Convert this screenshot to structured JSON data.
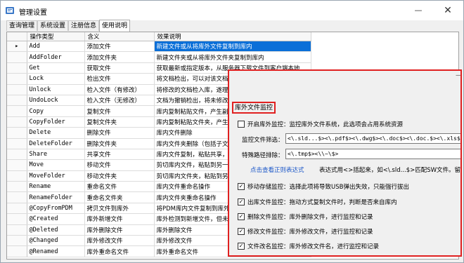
{
  "window": {
    "title": "管理设置",
    "minimize": "—",
    "close": "✕"
  },
  "tabs": [
    "查询管理",
    "系统设置",
    "注册信息",
    "使用说明"
  ],
  "grid": {
    "columns": [
      "操作类型",
      "含义",
      "效果说明"
    ],
    "rows": [
      [
        "Add",
        "添加文件",
        "新建文件或从将库外文件复制到库内"
      ],
      [
        "AddFolder",
        "添加文件夹",
        "新建文件夹或从将库外文件夹复制到库内"
      ],
      [
        "Get",
        "获取文件",
        "获取最新或指定版本，从服务器下载文件到客户端本地"
      ],
      [
        "Lock",
        "检出文件",
        "将文档检出，可以对该文档检出"
      ],
      [
        "Unlock",
        "检入文件（有修改）",
        "将修改的文档检入库，遂理版"
      ],
      [
        "UndoLock",
        "检入文件（无修改）",
        "文档为撤销检出，将未修改的"
      ],
      [
        "Copy",
        "复制文件",
        "库内复制粘贴文件，产生副本"
      ],
      [
        "CopyFolder",
        "复制文件夹",
        "库内复制粘贴文件夹，产生副"
      ],
      [
        "Delete",
        "删除文件",
        "库内文件删除"
      ],
      [
        "DeleteFolder",
        "删除文件夹",
        "库内文件夹删除（包括子文件"
      ],
      [
        "Share",
        "共享文件",
        "库内文件复制，粘贴共享，产"
      ],
      [
        "Move",
        "移动文件",
        "剪切库内文件，粘贴到另一个"
      ],
      [
        "MoveFolder",
        "移动文件夹",
        "剪切库内文件夹，粘贴到另一"
      ],
      [
        "Rename",
        "重命名文件",
        "库内文件重命名操作"
      ],
      [
        "RenameFolder",
        "重命名文件夹",
        "库内文件夹重命名操作"
      ],
      [
        "@CopyFromPDM",
        "拷贝文件到库外",
        "将PDM库内文件复制到库外"
      ],
      [
        "@Created",
        "库外新增文件",
        "库外检测到新增文件，但未"
      ],
      [
        "@Deleted",
        "库外删除文件",
        "库外删除文件"
      ],
      [
        "@Changed",
        "库外修改文件",
        "库外修改文件"
      ],
      [
        "@Renamed",
        "库外重命名文件",
        "库外重命名文件"
      ]
    ],
    "selected_row_marker": "▸"
  },
  "monitor": {
    "minimize": "—",
    "section_title": "库外文件监控",
    "enable_label": "开启库外监控：监控库外文件系统，此选项会占用系统资源",
    "filter_label": "监控文件筛选：",
    "filter_value": "<\\.sld...$><\\.pdf$><\\.dwg$><\\.doc$><\\.doc.$><\\.xls$><\\.xls.$>",
    "exclude_label": "特殊路径排除：",
    "exclude_value": "<\\.tmp$><\\\\~\\$>",
    "regex_link": "点击查看正则表达式",
    "hint_text": "表达式用<>括起来，如<\\.sld...$>匹配SW文件。留空则不做",
    "options": [
      {
        "label": "移动存储监控：选择此项将导致USB弹出失效，只能强行拔出",
        "checked": true
      },
      {
        "label": "出库文件监控：拖动方式复制文件时，判断是否来自库内",
        "checked": true
      },
      {
        "label": "删除文件监控：库外删除文件，进行监控和记录",
        "checked": true
      },
      {
        "label": "修改文件监控：库外修改文件，进行监控和记录",
        "checked": true
      },
      {
        "label": "文件改名监控：库外修改文件名，进行监控和记录",
        "checked": true
      }
    ]
  },
  "colors": {
    "accent_red": "#e02020",
    "selection_blue": "#0a6fd8",
    "link_blue": "#1a56c8"
  }
}
